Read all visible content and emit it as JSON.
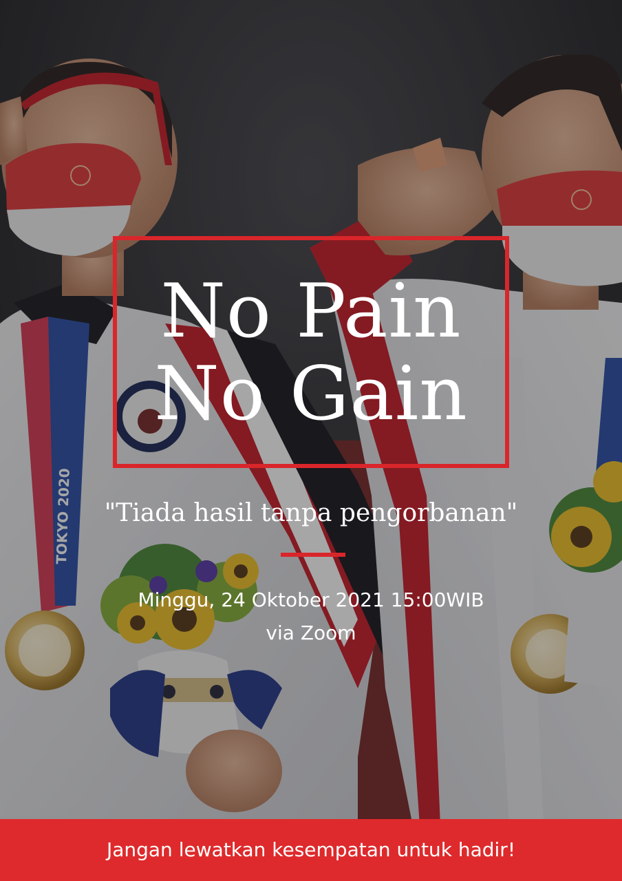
{
  "title": {
    "line1": "No Pain",
    "line2": "No Gain"
  },
  "subtitle": "\"Tiada hasil tanpa pengorbanan\"",
  "event": {
    "date": "Minggu, 24 Oktober 2021 15:00WIB",
    "venue": "via Zoom"
  },
  "footer": {
    "text": "Jangan lewatkan kesempatan untuk hadir!"
  },
  "photo": {
    "lanyard_text": "TOKYO 2020"
  },
  "colors": {
    "accent": "#d9262b",
    "footer_bg": "#de2a2c",
    "text": "#ffffff"
  }
}
